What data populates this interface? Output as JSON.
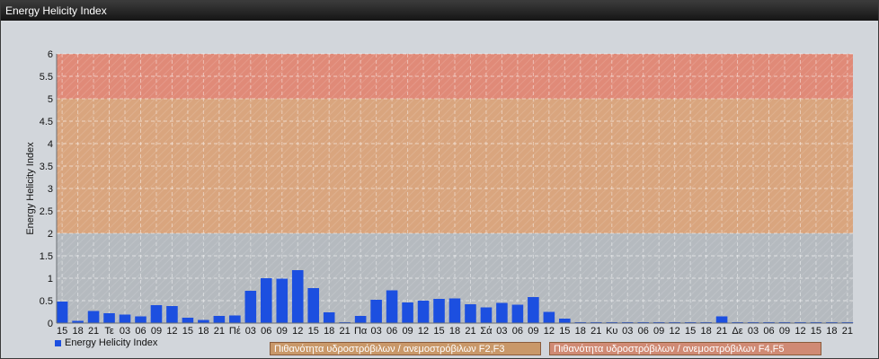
{
  "window": {
    "title": "Energy Helicity Index"
  },
  "colors": {
    "bar": "#1c4fe0",
    "band_low": "#b5babf",
    "band_f23": "#d9a57e",
    "band_f45": "#e08a78"
  },
  "legend": {
    "series_label": "Energy Helicity Index",
    "band_f23_label": "Πιθανότητα υδροστρόβιλων / ανεμοστρόβιλων F2,F3",
    "band_f45_label": "Πιθανότητα υδροστρόβιλων / ανεμοστρόβιλων F4,F5"
  },
  "chart_data": {
    "type": "bar",
    "ylabel": "Energy Helicity Index",
    "ylim": [
      0,
      6
    ],
    "yticks": [
      "0",
      "0.5",
      "1",
      "1.5",
      "2",
      "2.5",
      "3",
      "3.5",
      "4",
      "4.5",
      "5",
      "5.5",
      "6"
    ],
    "grid": true,
    "bands": [
      {
        "from": 0,
        "to": 2,
        "label": ""
      },
      {
        "from": 2,
        "to": 5,
        "label": "Πιθανότητα υδροστρόβιλων / ανεμοστρόβιλων F2,F3"
      },
      {
        "from": 5,
        "to": 6,
        "label": "Πιθανότητα υδροστρόβιλων / ανεμοστρόβιλων F4,F5"
      }
    ],
    "categories": [
      "15",
      "18",
      "21",
      "Τε",
      "03",
      "06",
      "09",
      "12",
      "15",
      "18",
      "21",
      "Πέ",
      "03",
      "06",
      "09",
      "12",
      "15",
      "18",
      "21",
      "Πα",
      "03",
      "06",
      "09",
      "12",
      "15",
      "18",
      "21",
      "Σά",
      "03",
      "06",
      "09",
      "12",
      "15",
      "18",
      "21",
      "Κυ",
      "03",
      "06",
      "09",
      "12",
      "15",
      "18",
      "21",
      "Δε",
      "03",
      "06",
      "09",
      "12",
      "15",
      "18",
      "21"
    ],
    "series": [
      {
        "values": [
          0.48,
          0.05,
          0.27,
          0.22,
          0.19,
          0.15,
          0.4,
          0.38,
          0.12,
          0.07,
          0.16,
          0.17,
          0.72,
          1.0,
          0.99,
          1.18,
          0.78,
          0.24,
          0.02,
          0.16,
          0.52,
          0.73,
          0.46,
          0.5,
          0.54,
          0.55,
          0.42,
          0.35,
          0.45,
          0.41,
          0.58,
          0.25,
          0.1,
          0.02,
          0.02,
          0.02,
          0.02,
          0.02,
          0.02,
          0.02,
          0.02,
          0.02,
          0.15,
          0.02,
          0.02,
          0.02,
          0.02,
          0.02,
          0.02,
          0.02,
          0.02
        ]
      }
    ]
  }
}
